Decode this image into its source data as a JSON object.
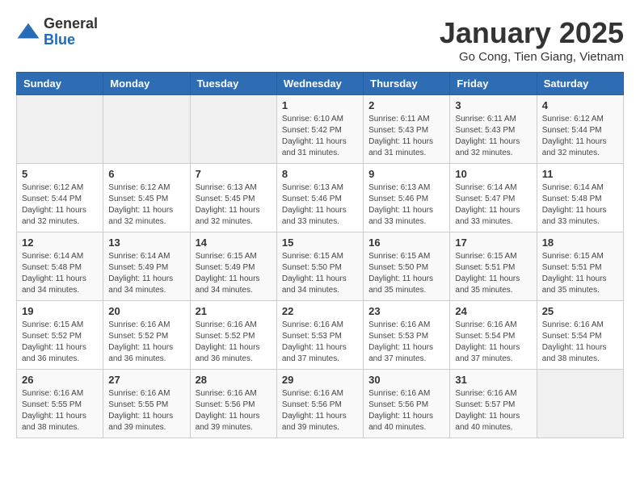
{
  "header": {
    "logo_general": "General",
    "logo_blue": "Blue",
    "month_title": "January 2025",
    "location": "Go Cong, Tien Giang, Vietnam"
  },
  "days_of_week": [
    "Sunday",
    "Monday",
    "Tuesday",
    "Wednesday",
    "Thursday",
    "Friday",
    "Saturday"
  ],
  "weeks": [
    [
      {
        "day": "",
        "info": ""
      },
      {
        "day": "",
        "info": ""
      },
      {
        "day": "",
        "info": ""
      },
      {
        "day": "1",
        "info": "Sunrise: 6:10 AM\nSunset: 5:42 PM\nDaylight: 11 hours and 31 minutes."
      },
      {
        "day": "2",
        "info": "Sunrise: 6:11 AM\nSunset: 5:43 PM\nDaylight: 11 hours and 31 minutes."
      },
      {
        "day": "3",
        "info": "Sunrise: 6:11 AM\nSunset: 5:43 PM\nDaylight: 11 hours and 32 minutes."
      },
      {
        "day": "4",
        "info": "Sunrise: 6:12 AM\nSunset: 5:44 PM\nDaylight: 11 hours and 32 minutes."
      }
    ],
    [
      {
        "day": "5",
        "info": "Sunrise: 6:12 AM\nSunset: 5:44 PM\nDaylight: 11 hours and 32 minutes."
      },
      {
        "day": "6",
        "info": "Sunrise: 6:12 AM\nSunset: 5:45 PM\nDaylight: 11 hours and 32 minutes."
      },
      {
        "day": "7",
        "info": "Sunrise: 6:13 AM\nSunset: 5:45 PM\nDaylight: 11 hours and 32 minutes."
      },
      {
        "day": "8",
        "info": "Sunrise: 6:13 AM\nSunset: 5:46 PM\nDaylight: 11 hours and 33 minutes."
      },
      {
        "day": "9",
        "info": "Sunrise: 6:13 AM\nSunset: 5:46 PM\nDaylight: 11 hours and 33 minutes."
      },
      {
        "day": "10",
        "info": "Sunrise: 6:14 AM\nSunset: 5:47 PM\nDaylight: 11 hours and 33 minutes."
      },
      {
        "day": "11",
        "info": "Sunrise: 6:14 AM\nSunset: 5:48 PM\nDaylight: 11 hours and 33 minutes."
      }
    ],
    [
      {
        "day": "12",
        "info": "Sunrise: 6:14 AM\nSunset: 5:48 PM\nDaylight: 11 hours and 34 minutes."
      },
      {
        "day": "13",
        "info": "Sunrise: 6:14 AM\nSunset: 5:49 PM\nDaylight: 11 hours and 34 minutes."
      },
      {
        "day": "14",
        "info": "Sunrise: 6:15 AM\nSunset: 5:49 PM\nDaylight: 11 hours and 34 minutes."
      },
      {
        "day": "15",
        "info": "Sunrise: 6:15 AM\nSunset: 5:50 PM\nDaylight: 11 hours and 34 minutes."
      },
      {
        "day": "16",
        "info": "Sunrise: 6:15 AM\nSunset: 5:50 PM\nDaylight: 11 hours and 35 minutes."
      },
      {
        "day": "17",
        "info": "Sunrise: 6:15 AM\nSunset: 5:51 PM\nDaylight: 11 hours and 35 minutes."
      },
      {
        "day": "18",
        "info": "Sunrise: 6:15 AM\nSunset: 5:51 PM\nDaylight: 11 hours and 35 minutes."
      }
    ],
    [
      {
        "day": "19",
        "info": "Sunrise: 6:15 AM\nSunset: 5:52 PM\nDaylight: 11 hours and 36 minutes."
      },
      {
        "day": "20",
        "info": "Sunrise: 6:16 AM\nSunset: 5:52 PM\nDaylight: 11 hours and 36 minutes."
      },
      {
        "day": "21",
        "info": "Sunrise: 6:16 AM\nSunset: 5:52 PM\nDaylight: 11 hours and 36 minutes."
      },
      {
        "day": "22",
        "info": "Sunrise: 6:16 AM\nSunset: 5:53 PM\nDaylight: 11 hours and 37 minutes."
      },
      {
        "day": "23",
        "info": "Sunrise: 6:16 AM\nSunset: 5:53 PM\nDaylight: 11 hours and 37 minutes."
      },
      {
        "day": "24",
        "info": "Sunrise: 6:16 AM\nSunset: 5:54 PM\nDaylight: 11 hours and 37 minutes."
      },
      {
        "day": "25",
        "info": "Sunrise: 6:16 AM\nSunset: 5:54 PM\nDaylight: 11 hours and 38 minutes."
      }
    ],
    [
      {
        "day": "26",
        "info": "Sunrise: 6:16 AM\nSunset: 5:55 PM\nDaylight: 11 hours and 38 minutes."
      },
      {
        "day": "27",
        "info": "Sunrise: 6:16 AM\nSunset: 5:55 PM\nDaylight: 11 hours and 39 minutes."
      },
      {
        "day": "28",
        "info": "Sunrise: 6:16 AM\nSunset: 5:56 PM\nDaylight: 11 hours and 39 minutes."
      },
      {
        "day": "29",
        "info": "Sunrise: 6:16 AM\nSunset: 5:56 PM\nDaylight: 11 hours and 39 minutes."
      },
      {
        "day": "30",
        "info": "Sunrise: 6:16 AM\nSunset: 5:56 PM\nDaylight: 11 hours and 40 minutes."
      },
      {
        "day": "31",
        "info": "Sunrise: 6:16 AM\nSunset: 5:57 PM\nDaylight: 11 hours and 40 minutes."
      },
      {
        "day": "",
        "info": ""
      }
    ]
  ]
}
